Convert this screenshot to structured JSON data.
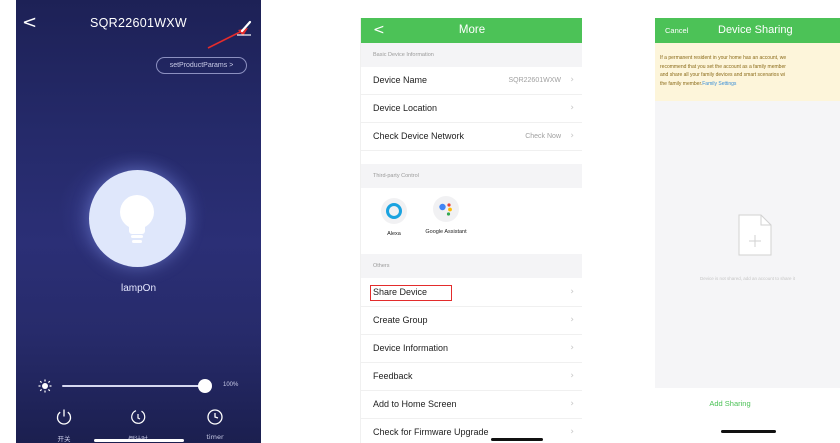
{
  "lamp_screen": {
    "title": "SQR22601WXW",
    "params_button": "setProductParams >",
    "state_label": "lampOn",
    "brightness_percent": "100%",
    "brightness_level": 1.0,
    "controls": [
      {
        "label": "开关",
        "icon": "power-icon"
      },
      {
        "label": "倒计时",
        "icon": "countdown-icon"
      },
      {
        "label": "timer",
        "icon": "clock-icon"
      }
    ],
    "colors": {
      "background": "#252a6a",
      "bulb": "#dfe7fb",
      "annotation_arrow": "#e32c2c"
    }
  },
  "more_screen": {
    "title": "More",
    "sections": {
      "basic": "Basic Device Information",
      "third_party": "Third-party Control",
      "others": "Others"
    },
    "basic_rows": [
      {
        "label": "Device Name",
        "value": "SQR22601WXW"
      },
      {
        "label": "Device Location",
        "value": ""
      },
      {
        "label": "Check Device Network",
        "value": "Check Now"
      }
    ],
    "third_party": [
      {
        "label": "Alexa",
        "icon": "alexa-icon"
      },
      {
        "label": "Google Assistant",
        "icon": "google-assistant-icon"
      }
    ],
    "other_rows": [
      {
        "label": "Share Device"
      },
      {
        "label": "Create Group"
      },
      {
        "label": "Device Information"
      },
      {
        "label": "Feedback"
      },
      {
        "label": "Add to Home Screen"
      },
      {
        "label": "Check for Firmware Upgrade"
      }
    ],
    "colors": {
      "nav": "#4cc257",
      "highlight_box": "#e32c2c"
    }
  },
  "sharing_screen": {
    "cancel": "Cancel",
    "title": "Device Sharing",
    "notice_lines": [
      "If a permanent resident in your home has an account, we",
      "recommend that you set the account as a family member",
      "and share all your family devices and smart scenarios wi",
      "the family member."
    ],
    "notice_link": "Family Settings",
    "empty_text": "Device is not shared, add an account to share it",
    "add_button": "Add Sharing",
    "colors": {
      "nav": "#4cc257",
      "notice_bg": "#fdf5da",
      "link": "#3a8fd8"
    }
  }
}
